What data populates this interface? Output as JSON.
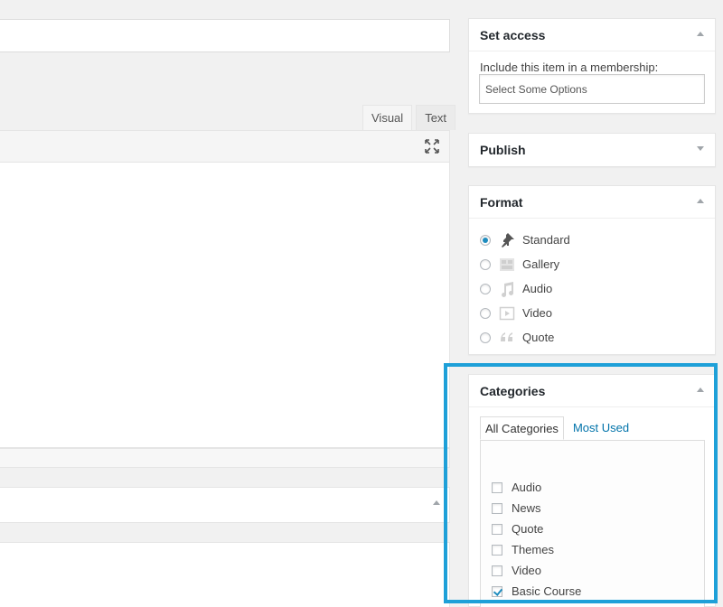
{
  "editor": {
    "tabs": [
      "Visual",
      "Text"
    ]
  },
  "set_access": {
    "title": "Set access",
    "label": "Include this item in a membership:",
    "select_placeholder": "Select Some Options"
  },
  "publish": {
    "title": "Publish"
  },
  "format": {
    "title": "Format",
    "options": [
      {
        "label": "Standard",
        "icon": "pin-icon",
        "checked": true
      },
      {
        "label": "Gallery",
        "icon": "gallery-icon",
        "checked": false
      },
      {
        "label": "Audio",
        "icon": "music-note-icon",
        "checked": false
      },
      {
        "label": "Video",
        "icon": "video-icon",
        "checked": false
      },
      {
        "label": "Quote",
        "icon": "quote-icon",
        "checked": false
      }
    ]
  },
  "categories": {
    "title": "Categories",
    "tabs": [
      "All Categories",
      "Most Used"
    ],
    "items": [
      {
        "label": "Audio",
        "checked": false
      },
      {
        "label": "News",
        "checked": false
      },
      {
        "label": "Quote",
        "checked": false
      },
      {
        "label": "Themes",
        "checked": false
      },
      {
        "label": "Video",
        "checked": false
      },
      {
        "label": "Basic Course",
        "checked": true
      }
    ]
  },
  "colors": {
    "highlight": "#1ea0d8",
    "link": "#0073aa",
    "radio_accent": "#1e8cbe"
  }
}
